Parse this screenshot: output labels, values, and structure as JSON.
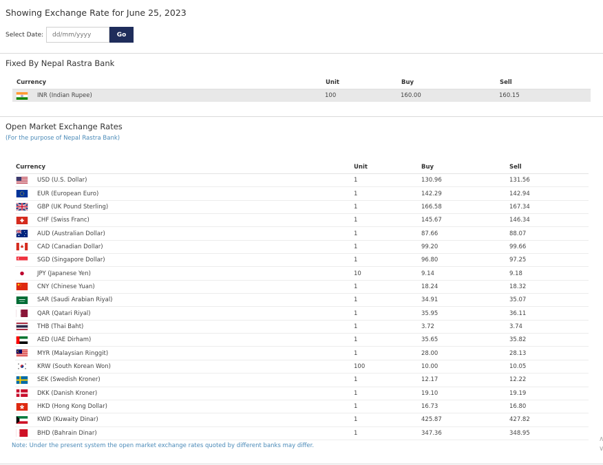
{
  "header": {
    "title": "Showing Exchange Rate for June 25, 2023",
    "date_label": "Select Date:",
    "date_placeholder": "dd/mm/yyyy",
    "go_label": "Go"
  },
  "fixed": {
    "title": "Fixed By Nepal Rastra Bank",
    "columns": [
      "Currency",
      "Unit",
      "Buy",
      "Sell"
    ],
    "rows": [
      {
        "flag": "india-flag-icon",
        "currency": "INR (Indian Rupee)",
        "unit": "100",
        "buy": "160.00",
        "sell": "160.15"
      }
    ]
  },
  "open": {
    "title": "Open Market Exchange Rates",
    "subtitle": "(For the purpose of Nepal Rastra Bank)",
    "columns": [
      "Currency",
      "Unit",
      "Buy",
      "Sell"
    ],
    "rows": [
      {
        "flag": "usa-flag-icon",
        "currency": "USD (U.S. Dollar)",
        "unit": "1",
        "buy": "130.96",
        "sell": "131.56"
      },
      {
        "flag": "eu-flag-icon",
        "currency": "EUR (European Euro)",
        "unit": "1",
        "buy": "142.29",
        "sell": "142.94"
      },
      {
        "flag": "uk-flag-icon",
        "currency": "GBP (UK Pound Sterling)",
        "unit": "1",
        "buy": "166.58",
        "sell": "167.34"
      },
      {
        "flag": "switzerland-flag-icon",
        "currency": "CHF (Swiss Franc)",
        "unit": "1",
        "buy": "145.67",
        "sell": "146.34"
      },
      {
        "flag": "australia-flag-icon",
        "currency": "AUD (Australian Dollar)",
        "unit": "1",
        "buy": "87.66",
        "sell": "88.07"
      },
      {
        "flag": "canada-flag-icon",
        "currency": "CAD (Canadian Dollar)",
        "unit": "1",
        "buy": "99.20",
        "sell": "99.66"
      },
      {
        "flag": "singapore-flag-icon",
        "currency": "SGD (Singapore Dollar)",
        "unit": "1",
        "buy": "96.80",
        "sell": "97.25"
      },
      {
        "flag": "japan-flag-icon",
        "currency": "JPY (Japanese Yen)",
        "unit": "10",
        "buy": "9.14",
        "sell": "9.18"
      },
      {
        "flag": "china-flag-icon",
        "currency": "CNY (Chinese Yuan)",
        "unit": "1",
        "buy": "18.24",
        "sell": "18.32"
      },
      {
        "flag": "saudi-arabia-flag-icon",
        "currency": "SAR (Saudi Arabian Riyal)",
        "unit": "1",
        "buy": "34.91",
        "sell": "35.07"
      },
      {
        "flag": "qatar-flag-icon",
        "currency": "QAR (Qatari Riyal)",
        "unit": "1",
        "buy": "35.95",
        "sell": "36.11"
      },
      {
        "flag": "thailand-flag-icon",
        "currency": "THB (Thai Baht)",
        "unit": "1",
        "buy": "3.72",
        "sell": "3.74"
      },
      {
        "flag": "uae-flag-icon",
        "currency": "AED (UAE Dirham)",
        "unit": "1",
        "buy": "35.65",
        "sell": "35.82"
      },
      {
        "flag": "malaysia-flag-icon",
        "currency": "MYR (Malaysian Ringgit)",
        "unit": "1",
        "buy": "28.00",
        "sell": "28.13"
      },
      {
        "flag": "south-korea-flag-icon",
        "currency": "KRW (South Korean Won)",
        "unit": "100",
        "buy": "10.00",
        "sell": "10.05"
      },
      {
        "flag": "sweden-flag-icon",
        "currency": "SEK (Swedish Kroner)",
        "unit": "1",
        "buy": "12.17",
        "sell": "12.22"
      },
      {
        "flag": "denmark-flag-icon",
        "currency": "DKK (Danish Kroner)",
        "unit": "1",
        "buy": "19.10",
        "sell": "19.19"
      },
      {
        "flag": "hong-kong-flag-icon",
        "currency": "HKD (Hong Kong Dollar)",
        "unit": "1",
        "buy": "16.73",
        "sell": "16.80"
      },
      {
        "flag": "kuwait-flag-icon",
        "currency": "KWD (Kuwaity Dinar)",
        "unit": "1",
        "buy": "425.87",
        "sell": "427.82"
      },
      {
        "flag": "bahrain-flag-icon",
        "currency": "BHD (Bahrain Dinar)",
        "unit": "1",
        "buy": "347.36",
        "sell": "348.95"
      }
    ],
    "note": "Note: Under the present system the open market exchange rates quoted by different banks may differ."
  },
  "colors": {
    "accent": "#1f2d5b",
    "note_blue": "#4a8ab8",
    "fixed_row_bg": "#e8e8e8"
  }
}
